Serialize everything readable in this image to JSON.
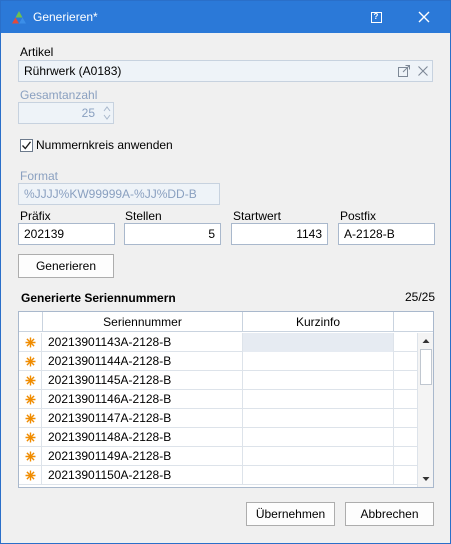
{
  "window": {
    "title": "Generieren*"
  },
  "artikel": {
    "label": "Artikel",
    "value": "Rührwerk (A0183)"
  },
  "gesamtanzahl": {
    "label": "Gesamtanzahl",
    "value": "25"
  },
  "nummernkreis": {
    "label": "Nummernkreis anwenden",
    "checked": true
  },
  "format": {
    "label": "Format",
    "value": "%JJJJ%KW99999A-%JJ%DD-B"
  },
  "praefix": {
    "label": "Präfix",
    "value": "202139"
  },
  "stellen": {
    "label": "Stellen",
    "value": "5"
  },
  "startwert": {
    "label": "Startwert",
    "value": "1143"
  },
  "postfix": {
    "label": "Postfix",
    "value": "A-2128-B"
  },
  "generate_button": "Generieren",
  "section": {
    "title": "Generierte Seriennummern",
    "counter": "25/25"
  },
  "grid": {
    "columns": [
      "Seriennummer",
      "Kurzinfo"
    ],
    "rows": [
      {
        "serial": "20213901143A-2128-B",
        "info": ""
      },
      {
        "serial": "20213901144A-2128-B",
        "info": ""
      },
      {
        "serial": "20213901145A-2128-B",
        "info": ""
      },
      {
        "serial": "20213901146A-2128-B",
        "info": ""
      },
      {
        "serial": "20213901147A-2128-B",
        "info": ""
      },
      {
        "serial": "20213901148A-2128-B",
        "info": ""
      },
      {
        "serial": "20213901149A-2128-B",
        "info": ""
      },
      {
        "serial": "20213901150A-2128-B",
        "info": ""
      }
    ]
  },
  "footer": {
    "apply_label": "Übernehmen",
    "cancel_label": "Abbrechen"
  },
  "colors": {
    "titlebar": "#2b79d8",
    "row_marker": "#f08c00"
  }
}
